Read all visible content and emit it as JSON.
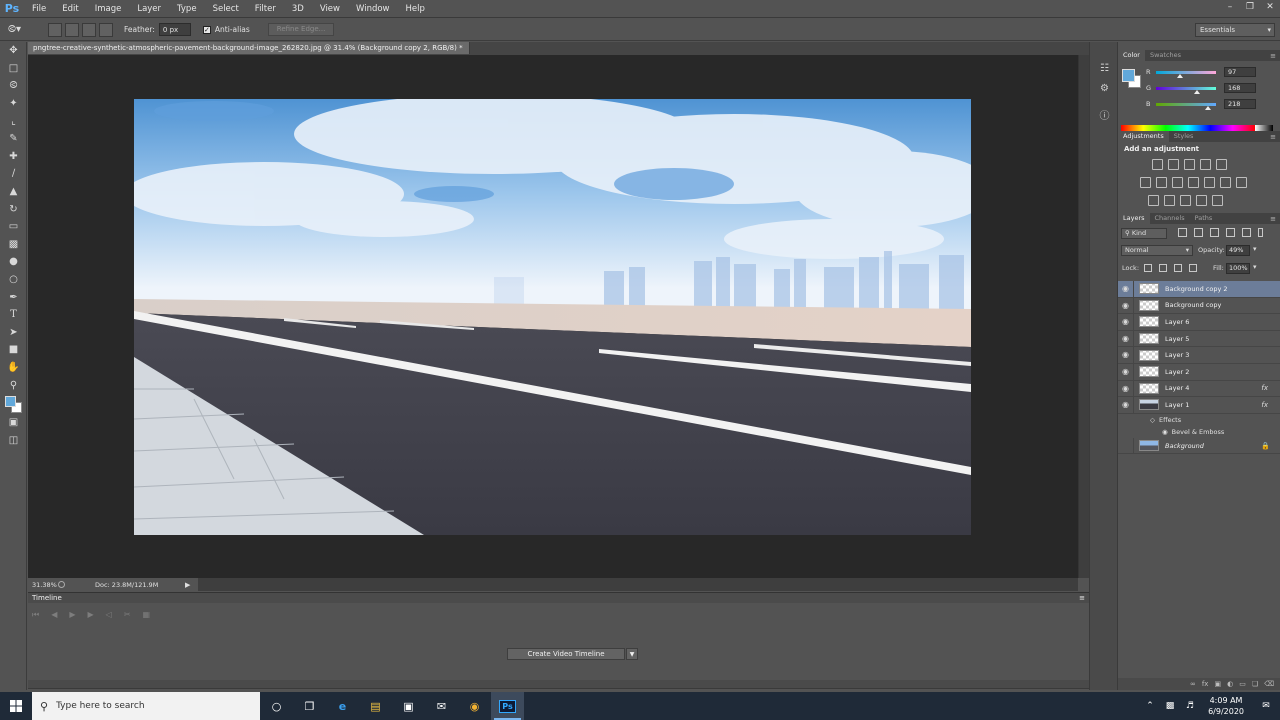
{
  "app": {
    "logo": "Ps"
  },
  "menu": [
    "File",
    "Edit",
    "Image",
    "Layer",
    "Type",
    "Select",
    "Filter",
    "3D",
    "View",
    "Window",
    "Help"
  ],
  "window_controls": [
    "–",
    "❐",
    "✕"
  ],
  "options_bar": {
    "feather_label": "Feather:",
    "feather_value": "0 px",
    "antialias_label": "Anti-alias",
    "refine_edge": "Refine Edge...",
    "workspace": "Essentials"
  },
  "document": {
    "tab_title": "pngtree-creative-synthetic-atmospheric-pavement-background-image_262820.jpg @ 31.4% (Background copy 2, RGB/8) *",
    "close": "×"
  },
  "status": {
    "zoom": "31.38%",
    "doc_size": "Doc: 23.8M/121.9M"
  },
  "timeline": {
    "title": "Timeline",
    "create_button": "Create Video Timeline"
  },
  "color_panel": {
    "tabs": [
      "Color",
      "Swatches"
    ],
    "channels": [
      {
        "label": "R",
        "value": "97",
        "pos": 0.38
      },
      {
        "label": "G",
        "value": "168",
        "pos": 0.66
      },
      {
        "label": "B",
        "value": "218",
        "pos": 0.85
      }
    ],
    "fg_color": "#61a8da"
  },
  "adjustments_panel": {
    "tabs": [
      "Adjustments",
      "Styles"
    ],
    "title": "Add an adjustment"
  },
  "layers_panel": {
    "tabs": [
      "Layers",
      "Channels",
      "Paths"
    ],
    "filter": "Kind",
    "blend_mode": "Normal",
    "opacity_label": "Opacity:",
    "opacity": "49%",
    "lock_label": "Lock:",
    "fill_label": "Fill:",
    "fill": "100%",
    "layers": [
      {
        "name": "Background copy 2"
      },
      {
        "name": "Background copy"
      },
      {
        "name": "Layer 6"
      },
      {
        "name": "Layer 5"
      },
      {
        "name": "Layer 3"
      },
      {
        "name": "Layer 2"
      },
      {
        "name": "Layer 4",
        "fx": "fx"
      },
      {
        "name": "Layer 1",
        "fx": "fx"
      }
    ],
    "effects_label": "Effects",
    "effect_item": "Bevel & Emboss",
    "background_layer": "Background"
  },
  "taskbar": {
    "search_placeholder": "Type here to search",
    "time": "4:09 AM",
    "date": "6/9/2020"
  }
}
